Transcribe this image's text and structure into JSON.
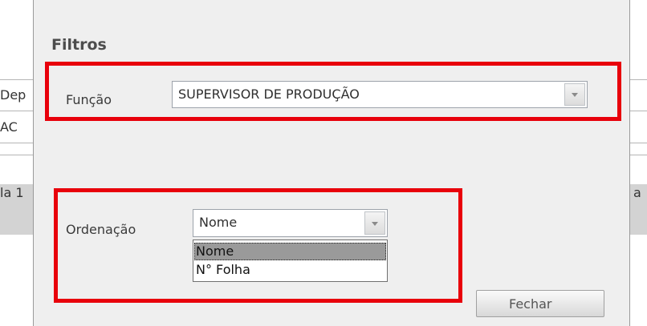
{
  "background": {
    "fragments": [
      "Dep",
      "AC",
      "la 1",
      "a"
    ]
  },
  "dialog": {
    "title": "Filtros",
    "funcao": {
      "label": "Função",
      "value": "SUPERVISOR DE PRODUÇÃO"
    },
    "ordenacao": {
      "label": "Ordenação",
      "value": "Nome",
      "options": [
        "Nome",
        "N° Folha"
      ],
      "highlighted_option": "Nome"
    },
    "close_label": "Fechar"
  },
  "colors": {
    "highlight": "#e8000b",
    "dialog_background": "#efefef",
    "selected_option": "#9a9a9a"
  }
}
